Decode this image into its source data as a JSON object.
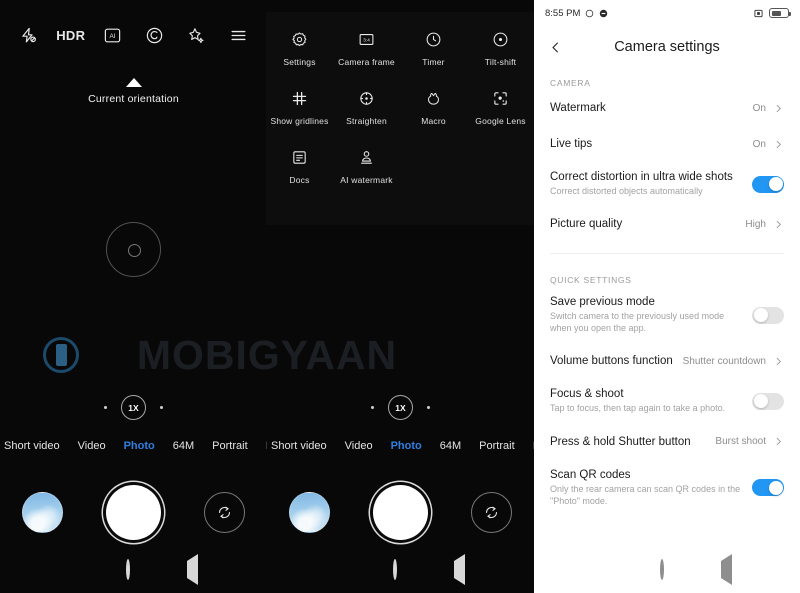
{
  "camera": {
    "top_icons": [
      {
        "name": "flash-off-icon",
        "label": "Flash off"
      },
      {
        "name": "hdr-icon",
        "label": "HDR"
      },
      {
        "name": "ai-icon",
        "label": "AI"
      },
      {
        "name": "bokeh-icon",
        "label": "Bokeh"
      },
      {
        "name": "beauty-icon",
        "label": "Beauty"
      },
      {
        "name": "menu-icon",
        "label": "Menu"
      }
    ],
    "hdr_label": "HDR",
    "orientation_label": "Current orientation",
    "zoom_level": "1X",
    "modes": [
      {
        "label": "Short video",
        "active": false,
        "cut": false
      },
      {
        "label": "Video",
        "active": false,
        "cut": false
      },
      {
        "label": "Photo",
        "active": true,
        "cut": false
      },
      {
        "label": "64M",
        "active": false,
        "cut": false
      },
      {
        "label": "Portrait",
        "active": false,
        "cut": false
      },
      {
        "label": "N",
        "active": false,
        "cut": true
      }
    ],
    "gallery_thumb_name": "gallery-thumbnail",
    "shutter_name": "shutter-button",
    "flip_name": "flip-camera-button",
    "watermark_text": "MOBIGYAAN"
  },
  "menu_overlay": {
    "items": [
      {
        "label": "Settings",
        "icon": "settings-gear-icon"
      },
      {
        "label": "Camera frame",
        "icon": "camera-frame-icon"
      },
      {
        "label": "Timer",
        "icon": "timer-icon"
      },
      {
        "label": "Tilt-shift",
        "icon": "tilt-shift-icon"
      },
      {
        "label": "Show gridlines",
        "icon": "gridlines-icon"
      },
      {
        "label": "Straighten",
        "icon": "straighten-icon"
      },
      {
        "label": "Macro",
        "icon": "macro-flower-icon"
      },
      {
        "label": "Google Lens",
        "icon": "google-lens-icon"
      },
      {
        "label": "Docs",
        "icon": "docs-icon"
      },
      {
        "label": "AI watermark",
        "icon": "ai-watermark-icon"
      }
    ]
  },
  "settings": {
    "statusbar": {
      "time": "8:55 PM",
      "left_icons": [
        "mute-icon",
        "dnd-icon"
      ],
      "right_icons": [
        "vibrate-icon",
        "battery-icon"
      ]
    },
    "title": "Camera settings",
    "back_icon": "back-chevron-icon",
    "sections": [
      {
        "label": "CAMERA",
        "rows": [
          {
            "title": "Watermark",
            "sub": "",
            "value": "On",
            "control": "chevron",
            "toggle": null
          },
          {
            "title": "Live tips",
            "sub": "",
            "value": "On",
            "control": "chevron",
            "toggle": null
          },
          {
            "title": "Correct distortion in ultra wide shots",
            "sub": "Correct distorted objects automatically",
            "value": "",
            "control": "toggle",
            "toggle": true
          },
          {
            "title": "Picture quality",
            "sub": "",
            "value": "High",
            "control": "chevron",
            "toggle": null
          }
        ]
      },
      {
        "label": "QUICK SETTINGS",
        "rows": [
          {
            "title": "Save previous mode",
            "sub": "Switch camera to the previously used mode when you open the app.",
            "value": "",
            "control": "toggle",
            "toggle": false
          },
          {
            "title": "Volume buttons function",
            "sub": "",
            "value": "Shutter countdown",
            "control": "chevron",
            "toggle": null
          },
          {
            "title": "Focus & shoot",
            "sub": "Tap to focus, then tap again to take a photo.",
            "value": "",
            "control": "toggle",
            "toggle": false
          },
          {
            "title": "Press & hold Shutter button",
            "sub": "",
            "value": "Burst shoot",
            "control": "chevron",
            "toggle": null
          },
          {
            "title": "Scan QR codes",
            "sub": "Only the rear camera can scan QR codes in the \"Photo\" mode.",
            "value": "",
            "control": "toggle",
            "toggle": true
          }
        ]
      }
    ],
    "accent_color": "#2196f3"
  },
  "navbar": {
    "recents": "recents-square-icon",
    "home": "home-circle-icon",
    "back": "back-triangle-icon"
  }
}
